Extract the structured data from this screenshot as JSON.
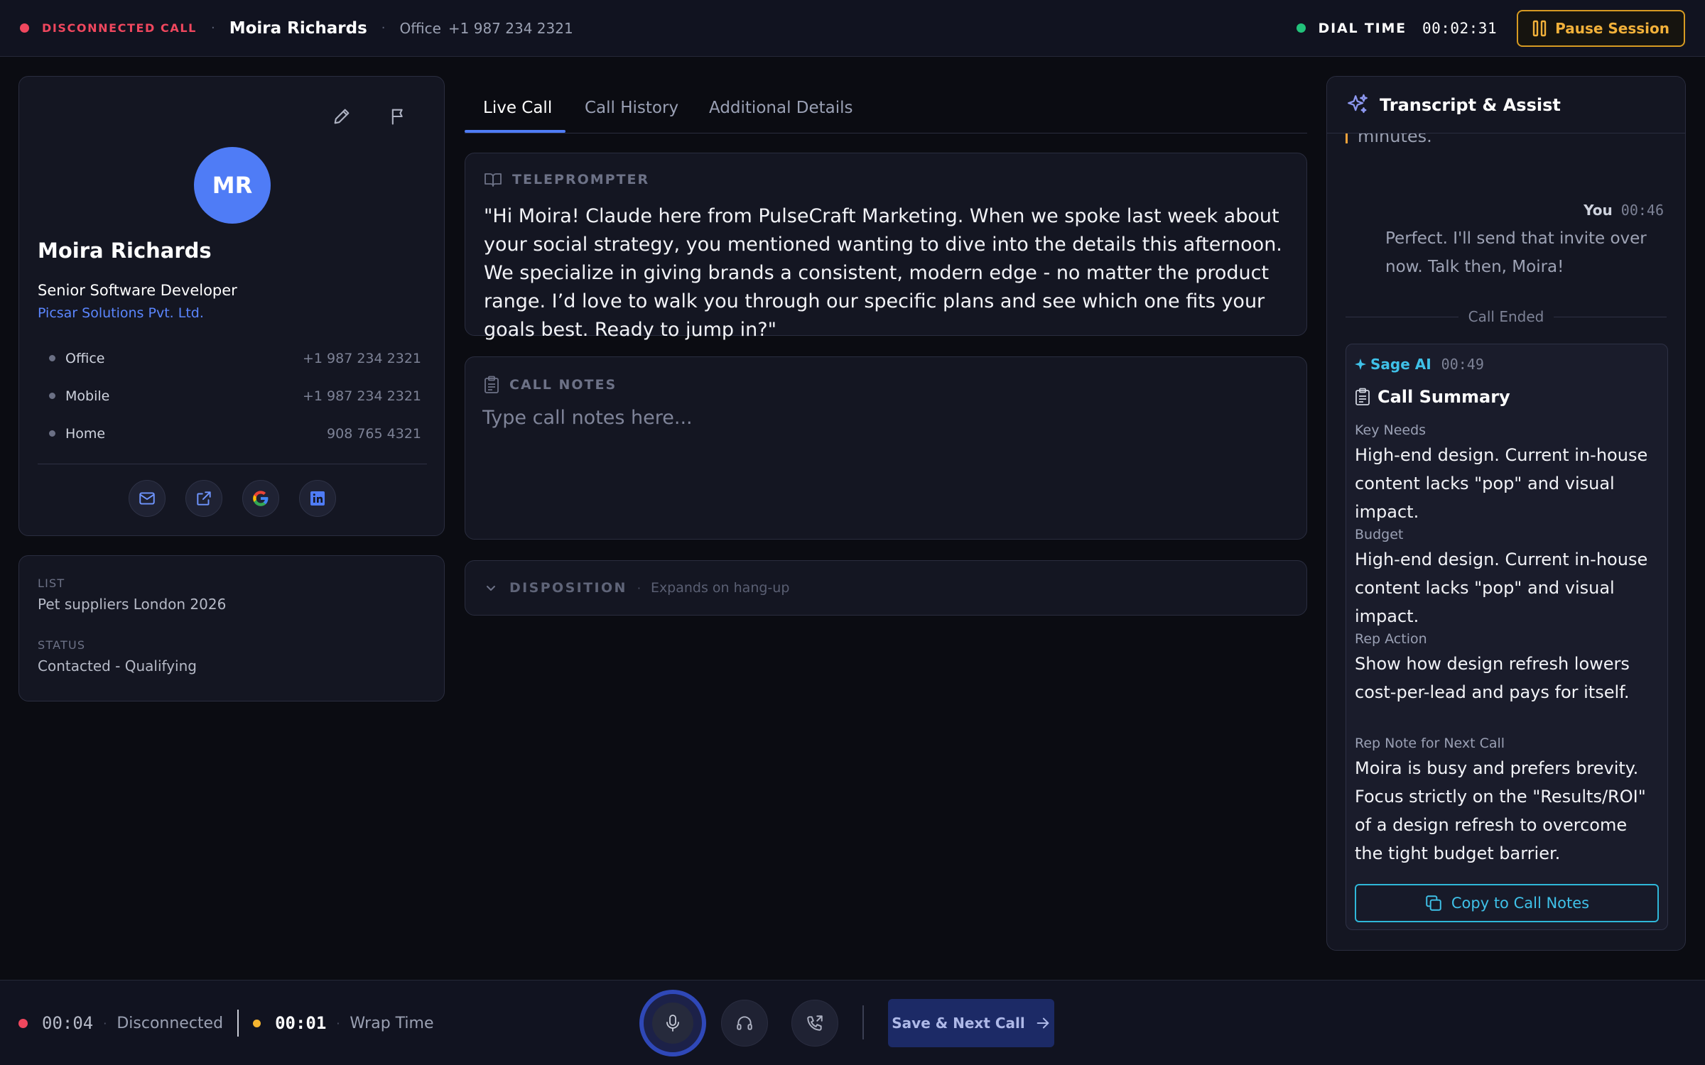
{
  "topbar": {
    "status": "DISCONNECTED CALL",
    "separator": "·",
    "contact_name": "Moira Richards",
    "phone_label": "Office",
    "phone": "+1 987 234 2321",
    "dial_label": "DIAL TIME",
    "dial_time": "00:02:31",
    "pause_label": "Pause Session"
  },
  "contact": {
    "initials": "MR",
    "name": "Moira Richards",
    "title": "Senior Software Developer",
    "company": "Picsar Solutions Pvt. Ltd.",
    "phones": [
      {
        "label": "Office",
        "value": "+1 987 234 2321"
      },
      {
        "label": "Mobile",
        "value": "+1 987 234 2321"
      },
      {
        "label": "Home",
        "value": "908 765 4321"
      }
    ],
    "actions": [
      "mail-icon",
      "external-link-icon",
      "google-icon",
      "linkedin-icon"
    ]
  },
  "list_info": {
    "list_label": "LIST",
    "list_value": "Pet suppliers London 2026",
    "status_label": "STATUS",
    "status_value": "Contacted - Qualifying"
  },
  "tabs": [
    {
      "label": "Live Call",
      "active": true
    },
    {
      "label": "Call History",
      "active": false
    },
    {
      "label": "Additional Details",
      "active": false
    }
  ],
  "teleprompter": {
    "label": "TELEPROMPTER",
    "text": "\"Hi Moira! Claude here from PulseCraft Marketing. When we spoke last week about your social strategy, you mentioned wanting to dive into the details this afternoon. We specialize in giving brands a consistent, modern edge - no matter the product range. I’d love to walk you through our specific plans and see which one fits your goals best. Ready to jump in?\""
  },
  "notes": {
    "label": "CALL NOTES",
    "placeholder": "Type call notes here..."
  },
  "disposition": {
    "label": "DISPOSITION",
    "separator": "·",
    "hint": "Expands on hang-up"
  },
  "assist": {
    "title": "Transcript & Assist",
    "cut_text": "minutes.",
    "you_label": "You",
    "you_time": "00:46",
    "you_message": "Perfect. I'll send that invite over now. Talk then, Moira!",
    "ended_label": "Call Ended",
    "summary": {
      "ai_label": "Sage AI",
      "ai_time": "00:49",
      "title": "Call Summary",
      "key_needs_label": "Key Needs",
      "key_needs": "High-end design. Current in-house content lacks \"pop\" and visual impact.",
      "budget_label": "Budget",
      "budget": "High-end design. Current in-house content lacks \"pop\" and visual impact.",
      "rep_action_label": "Rep Action",
      "rep_action": "Show how design refresh lowers cost-per-lead and pays for itself.",
      "next_call_label": "Rep Note for Next Call",
      "next_call": "Moira is busy and prefers brevity. Focus strictly on the \"Results/ROI\" of a design refresh to overcome the tight budget barrier.",
      "copy_label": "Copy to Call Notes"
    }
  },
  "bottombar": {
    "call_time": "00:04",
    "separator": "·",
    "call_status": "Disconnected",
    "wrap_time": "00:01",
    "wrap_label": "Wrap Time",
    "next_label": "Save & Next Call"
  },
  "colors": {
    "accent_blue": "#4f7cf6",
    "status_red": "#f0475e",
    "status_green": "#22c27a",
    "status_yellow": "#f5b530",
    "pause_amber": "#d69a22",
    "ai_cyan": "#3fc1e8"
  }
}
